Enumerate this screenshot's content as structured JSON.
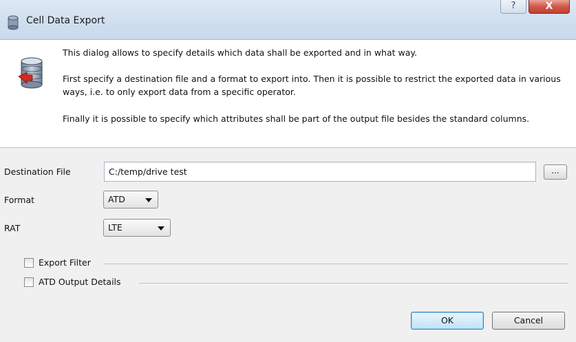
{
  "window": {
    "title": "Cell Data Export",
    "help_label": "?",
    "close_label": "X"
  },
  "info": {
    "para1": "This dialog allows to specify details  which data shall be exported and in what way.",
    "para2": "First specify a destination file and a format to export into. Then it is possible to restrict the exported data in various ways, i.e. to only export data from a specific operator.",
    "para3": "Finally it is possible to specify which attributes shall be part of the output file besides the standard columns."
  },
  "form": {
    "destination_label": "Destination File",
    "destination_value": "C:/temp/drive test",
    "browse_label": "...",
    "format_label": "Format",
    "format_value": "ATD",
    "rat_label": "RAT",
    "rat_value": "LTE"
  },
  "groups": {
    "export_filter_label": "Export Filter",
    "atd_details_label": "ATD Output Details"
  },
  "buttons": {
    "ok": "OK",
    "cancel": "Cancel"
  },
  "icons": {
    "title_icon": "database-icon",
    "header_icon": "database-export-icon"
  },
  "colors": {
    "titlebar": "#d2e0f0",
    "close_button": "#c3402f",
    "default_button": "#bfe3f7"
  }
}
